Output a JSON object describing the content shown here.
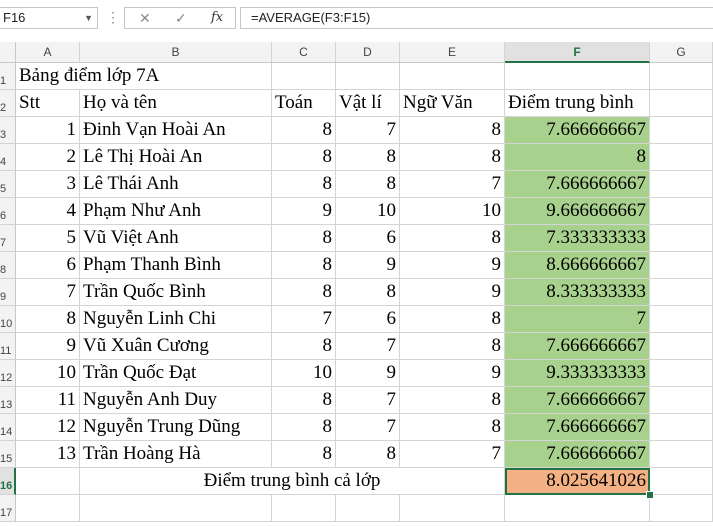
{
  "formula_bar": {
    "cell_ref": "F16",
    "dropdown_glyph": "▼",
    "separator": "⋮",
    "cancel_glyph": "✕",
    "enter_glyph": "✓",
    "fx_label": "fx",
    "formula": "=AVERAGE(F3:F15)"
  },
  "columns": [
    "A",
    "B",
    "C",
    "D",
    "E",
    "F",
    "G"
  ],
  "rows": [
    "1",
    "2",
    "3",
    "4",
    "5",
    "6",
    "7",
    "8",
    "9",
    "10",
    "11",
    "12",
    "13",
    "14",
    "15",
    "16",
    "17"
  ],
  "sheet": {
    "title": "Bảng điểm lớp 7A",
    "headers": {
      "stt": "Stt",
      "name": "Họ và tên",
      "math": "Toán",
      "physics": "Vật lí",
      "literature": "Ngữ Văn",
      "average": "Điểm trung bình"
    },
    "students": [
      {
        "stt": "1",
        "name": "Đinh Vạn Hoài An",
        "math": "8",
        "physics": "7",
        "literature": "8",
        "average": "7.666666667"
      },
      {
        "stt": "2",
        "name": "Lê Thị Hoài An",
        "math": "8",
        "physics": "8",
        "literature": "8",
        "average": "8"
      },
      {
        "stt": "3",
        "name": "Lê Thái Anh",
        "math": "8",
        "physics": "8",
        "literature": "7",
        "average": "7.666666667"
      },
      {
        "stt": "4",
        "name": "Phạm Như Anh",
        "math": "9",
        "physics": "10",
        "literature": "10",
        "average": "9.666666667"
      },
      {
        "stt": "5",
        "name": "Vũ Việt Anh",
        "math": "8",
        "physics": "6",
        "literature": "8",
        "average": "7.333333333"
      },
      {
        "stt": "6",
        "name": "Phạm Thanh Bình",
        "math": "8",
        "physics": "9",
        "literature": "9",
        "average": "8.666666667"
      },
      {
        "stt": "7",
        "name": "Trần Quốc Bình",
        "math": "8",
        "physics": "8",
        "literature": "9",
        "average": "8.333333333"
      },
      {
        "stt": "8",
        "name": "Nguyễn Linh Chi",
        "math": "7",
        "physics": "6",
        "literature": "8",
        "average": "7"
      },
      {
        "stt": "9",
        "name": "Vũ Xuân Cương",
        "math": "8",
        "physics": "7",
        "literature": "8",
        "average": "7.666666667"
      },
      {
        "stt": "10",
        "name": "Trần Quốc Đạt",
        "math": "10",
        "physics": "9",
        "literature": "9",
        "average": "9.333333333"
      },
      {
        "stt": "11",
        "name": "Nguyễn Anh Duy",
        "math": "8",
        "physics": "7",
        "literature": "8",
        "average": "7.666666667"
      },
      {
        "stt": "12",
        "name": "Nguyễn Trung Dũng",
        "math": "8",
        "physics": "7",
        "literature": "8",
        "average": "7.666666667"
      },
      {
        "stt": "13",
        "name": "Trần Hoàng Hà",
        "math": "8",
        "physics": "8",
        "literature": "7",
        "average": "7.666666667"
      }
    ],
    "summary_label": "Điểm trung bình cả lớp",
    "summary_value": "8.025641026"
  },
  "colors": {
    "average_fill": "#a9d18e",
    "result_fill": "#f4b183",
    "selection": "#217346"
  }
}
